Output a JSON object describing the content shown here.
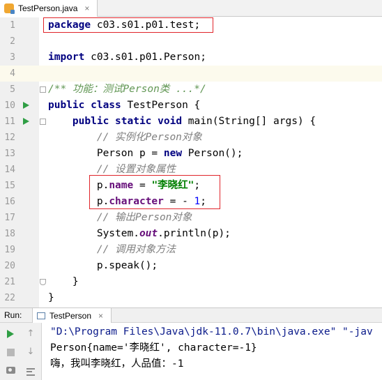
{
  "editor_tab": {
    "filename": "TestPerson.java",
    "close": "×"
  },
  "lines": [
    {
      "num": "1",
      "code": "package c03.s01.p01.test;"
    },
    {
      "num": "2",
      "code": ""
    },
    {
      "num": "3",
      "code": "import c03.s01.p01.Person;"
    },
    {
      "num": "4",
      "code": ""
    },
    {
      "num": "5",
      "doc": "/** 功能：测试Person类 ...*/"
    },
    {
      "num": "10",
      "kw1": "public class ",
      "rest": "TestPerson {"
    },
    {
      "num": "11",
      "indent": "    ",
      "kw1": "public static void ",
      "rest": "main(String[] args) {"
    },
    {
      "num": "12",
      "cmt": "        // 实例化Person对象"
    },
    {
      "num": "13",
      "pre": "        Person p = ",
      "kw1": "new ",
      "rest": "Person();"
    },
    {
      "num": "14",
      "cmt": "        // 设置对象属性"
    },
    {
      "num": "15",
      "pre": "        p.",
      "field": "name",
      "mid": " = ",
      "str": "\"李晓红\"",
      "post": ";"
    },
    {
      "num": "16",
      "pre": "        p.",
      "field": "character",
      "mid": " = - ",
      "numval": "1",
      "post": ";"
    },
    {
      "num": "17",
      "cmt": "        // 输出Person对象"
    },
    {
      "num": "18",
      "pre": "        System.",
      "sfield": "out",
      "post": ".println(p);"
    },
    {
      "num": "19",
      "cmt": "        // 调用对象方法"
    },
    {
      "num": "20",
      "code": "        p.speak();"
    },
    {
      "num": "21",
      "code": "    }"
    },
    {
      "num": "22",
      "code": "}"
    }
  ],
  "run_panel": {
    "label": "Run:",
    "tab_name": "TestPerson",
    "tab_close": "×",
    "output": [
      "\"D:\\Program Files\\Java\\jdk-11.0.7\\bin\\java.exe\" \"-jav",
      "Person{name='李晓红', character=-1}",
      "嗨，我叫李晓红，人品值：-1"
    ]
  },
  "icons": {
    "run": "play-icon",
    "stop": "stop-icon",
    "screenshot": "camera-icon",
    "up": "arrow-up-icon",
    "down": "arrow-down-icon",
    "soft_wrap": "lines-icon"
  },
  "colors": {
    "keyword": "#000080",
    "string": "#008000",
    "number": "#0000ff",
    "comment": "#808080",
    "field": "#660e7a",
    "highlight_box": "#e0242a",
    "run_green": "#2f9e44"
  }
}
